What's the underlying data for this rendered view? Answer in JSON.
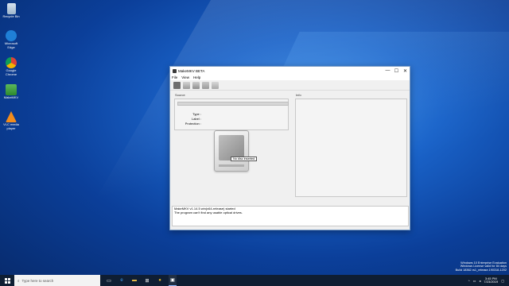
{
  "desktop": {
    "icons": [
      {
        "label": "Recycle Bin",
        "icon": "recycle-bin-icon"
      },
      {
        "label": "Microsoft Edge",
        "icon": "edge-icon"
      },
      {
        "label": "Google Chrome",
        "icon": "chrome-icon"
      },
      {
        "label": "MakeMKV",
        "icon": "makemkv-icon"
      },
      {
        "label": "VLC media player",
        "icon": "vlc-icon"
      }
    ]
  },
  "window": {
    "title": "MakeMKV BETA",
    "controls": {
      "minimize": "—",
      "maximize": "☐",
      "close": "✕"
    },
    "menu": [
      "File",
      "View",
      "Help"
    ],
    "toolbar": [
      "open-disc-icon",
      "open-files-icon",
      "save-icon",
      "settings-icon",
      "eject-icon"
    ],
    "source": {
      "label": "Source",
      "type_label": "Type :",
      "label_label": "Label :",
      "protection_label": "Protection :"
    },
    "drive_tooltip": "No disc inserted",
    "info_label": "Info",
    "log": [
      "MakeMKV v1.14.5 win(x64-release) started",
      "The program can't find any usable optical drives."
    ]
  },
  "taskbar": {
    "search_placeholder": "Type here to search",
    "clock_time": "3:45 PM",
    "clock_date": "7/23/2019"
  },
  "watermark": {
    "line1": "Windows 10 Enterprise Evaluation",
    "line2": "Windows License valid for 84 days",
    "line3": "Build 18362.rs1_release.190318-1202"
  }
}
